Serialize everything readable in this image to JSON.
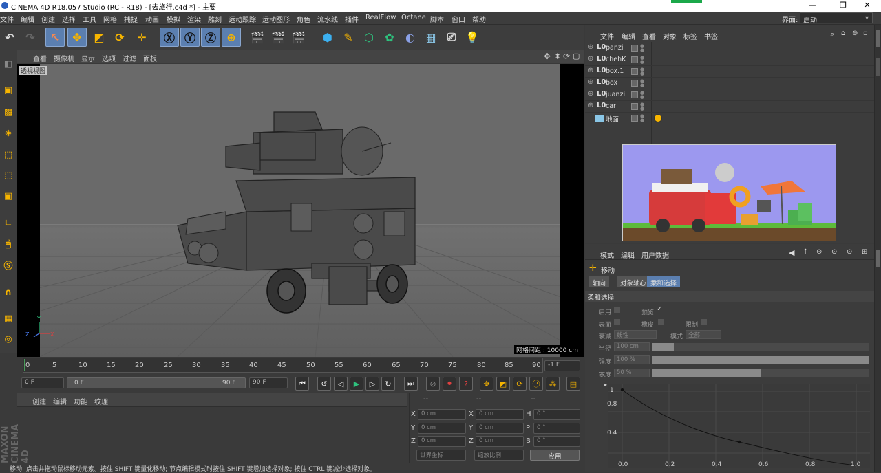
{
  "window": {
    "title": "CINEMA 4D R18.057 Studio (RC - R18) - [去旅行.c4d *] - 主要",
    "buttons": [
      "—",
      "❐",
      "✕"
    ]
  },
  "menu": [
    "文件",
    "编辑",
    "创建",
    "选择",
    "工具",
    "网格",
    "捕捉",
    "动画",
    "模拟",
    "渲染",
    "雕刻",
    "运动跟踪",
    "运动图形",
    "角色",
    "流水线",
    "插件",
    "RealFlow",
    "Octane",
    "脚本",
    "窗口",
    "帮助"
  ],
  "layout": {
    "label": "界面:",
    "value": "启动"
  },
  "viewport": {
    "menu": [
      "查看",
      "摄像机",
      "显示",
      "选项",
      "过滤",
      "面板"
    ],
    "label": "透视视图",
    "grid_info": "网格间距 : 10000 cm",
    "axes": [
      "Y",
      "Z",
      "X"
    ]
  },
  "timeline": {
    "ticks": [
      "0",
      "5",
      "10",
      "15",
      "20",
      "25",
      "30",
      "35",
      "40",
      "45",
      "50",
      "55",
      "60",
      "65",
      "70",
      "75",
      "80",
      "85",
      "90"
    ],
    "current": "-1 F"
  },
  "transport": {
    "start": "0 F",
    "range_start": "0 F",
    "range_end": "90 F",
    "end": "90 F"
  },
  "material": {
    "menu": [
      "创建",
      "编辑",
      "功能",
      "纹理"
    ],
    "brand": "MAXON CINEMA 4D"
  },
  "coords": {
    "headers": [
      "--",
      "--",
      "--"
    ],
    "rows": [
      {
        "a": "X",
        "av": "0 cm",
        "b": "X",
        "bv": "0 cm",
        "c": "H",
        "cv": "0 °"
      },
      {
        "a": "Y",
        "av": "0 cm",
        "b": "Y",
        "bv": "0 cm",
        "c": "P",
        "cv": "0 °"
      },
      {
        "a": "Z",
        "av": "0 cm",
        "b": "Z",
        "bv": "0 cm",
        "c": "B",
        "cv": "0 °"
      }
    ],
    "dropdown1": "世界坐标",
    "dropdown2": "缩放比例",
    "apply": "应用"
  },
  "objects": {
    "menu": [
      "文件",
      "编辑",
      "查看",
      "对象",
      "标签",
      "书签"
    ],
    "items": [
      {
        "icon": "L0",
        "name": "panzi"
      },
      {
        "icon": "L0",
        "name": "chehK"
      },
      {
        "icon": "L0",
        "name": "box.1"
      },
      {
        "icon": "L0",
        "name": "box"
      },
      {
        "icon": "L0",
        "name": "juanzi"
      },
      {
        "icon": "L0",
        "name": "car"
      },
      {
        "icon": "floor",
        "name": "地面"
      }
    ]
  },
  "attributes": {
    "menu": [
      "模式",
      "编辑",
      "用户数据"
    ],
    "tool": "移动",
    "tabs": [
      "轴向",
      "对象轴心",
      "柔和选择"
    ],
    "section": "柔和选择",
    "labels": {
      "enable": "启用",
      "preview": "预览",
      "surface": "表面",
      "rubber": "橡皮",
      "restrict": "限制",
      "falloff": "衰减",
      "falloff_val": "线性",
      "mode": "模式",
      "mode_val": "全部",
      "radius": "半径",
      "radius_val": "100 cm",
      "strength": "强度",
      "strength_val": "100 %",
      "width": "宽度",
      "width_val": "50 %"
    },
    "sliders": {
      "radius": 0.1,
      "strength": 1.0,
      "width": 0.5
    },
    "graph": {
      "y": [
        "1",
        "0.8",
        "0.4"
      ],
      "x": [
        "0.0",
        "0.2",
        "0.4",
        "0.6",
        "0.8",
        "1.0"
      ]
    }
  },
  "status": "移动: 点击并拖动鼠标移动元素。按住 SHIFT 键量化移动; 节点编辑模式时按住 SHIFT 键增加选择对象; 按住 CTRL 键减少选择对象。"
}
